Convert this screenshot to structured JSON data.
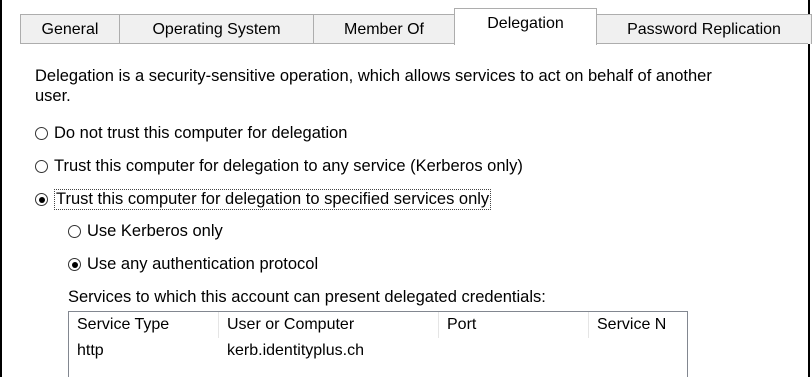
{
  "tabs": [
    {
      "label": "General"
    },
    {
      "label": "Operating System"
    },
    {
      "label": "Member Of"
    },
    {
      "label": "Delegation",
      "active": true
    },
    {
      "label": "Password Replication"
    }
  ],
  "description": "Delegation is a security-sensitive operation, which allows services to act on behalf of another user.",
  "delegation_options": [
    {
      "label": "Do not trust this computer for delegation",
      "checked": false
    },
    {
      "label": "Trust this computer for delegation to any service (Kerberos only)",
      "checked": false
    },
    {
      "label": "Trust this computer for delegation to specified services only",
      "checked": true
    }
  ],
  "protocol_options": [
    {
      "label": "Use Kerberos only",
      "checked": false
    },
    {
      "label": "Use any authentication protocol",
      "checked": true
    }
  ],
  "services": {
    "caption": "Services to which this account can present delegated credentials:",
    "columns": [
      "Service Type",
      "User or Computer",
      "Port",
      "Service N"
    ],
    "rows": [
      {
        "service_type": "http",
        "user_or_computer": "kerb.identityplus.ch",
        "port": "",
        "service_name": ""
      }
    ]
  }
}
